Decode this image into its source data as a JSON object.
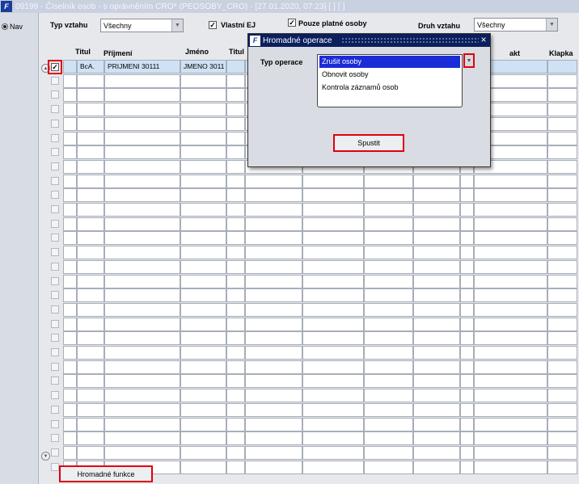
{
  "window": {
    "app_icon": "F",
    "title": "09199 - Číselník osob - s oprávněním CRO* (PEOSOBY_CRO) - [27.01.2020, 07:23]  [ ]  [ ]"
  },
  "nav": {
    "label": "Nav"
  },
  "filters": {
    "typ_vztahu_label": "Typ vztahu",
    "typ_vztahu_value": "Všechny",
    "vlastni_ej_label": "Vlastní EJ",
    "pouze_platne_label": "Pouze platné osoby",
    "druh_vztahu_label": "Druh vztahu",
    "druh_vztahu_value": "Všechny"
  },
  "columns": {
    "titul": "Titul",
    "prijmeni": "Příjmení",
    "jmeno": "Jméno",
    "titul2": "Titul",
    "kontakt": "akt",
    "klapka": "Klapka"
  },
  "first_row": {
    "titul": "BcA.",
    "prijmeni": "PRIJMENI 30111",
    "jmeno": "JMENO 3011"
  },
  "bottom": {
    "button_label": "Hromadné funkce"
  },
  "dialog": {
    "icon": "F",
    "title": "Hromadné operace",
    "close": "×",
    "typ_label": "Typ operace",
    "options": [
      "Zrušit osoby",
      "Obnovit osoby",
      "Kontrola záznamů osob"
    ],
    "selected_option": "Zrušit osoby",
    "run_button": "Spustit"
  },
  "colors": {
    "highlight": "#e0000f",
    "selection": "#1a2cd8",
    "dialog_title_bg": "#0a1f5c"
  }
}
